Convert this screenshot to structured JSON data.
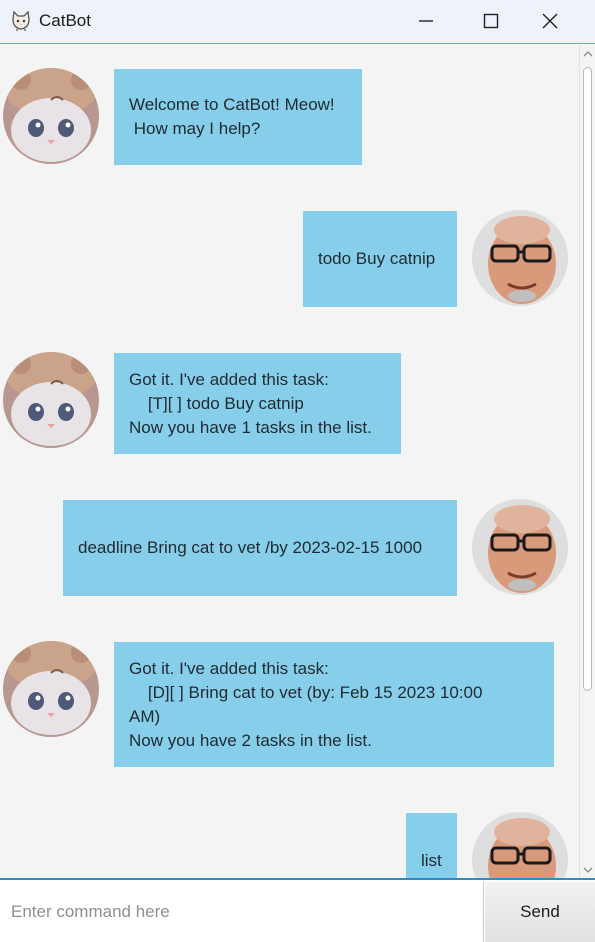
{
  "window": {
    "title": "CatBot"
  },
  "messages": [
    {
      "sender": "bot",
      "lines": [
        "Welcome to CatBot! Meow!",
        " How may I help?"
      ]
    },
    {
      "sender": "user",
      "lines": [
        "todo Buy catnip"
      ]
    },
    {
      "sender": "bot",
      "lines": [
        "Got it. I've added this task:",
        "    [T][ ] todo Buy catnip",
        "Now you have 1 tasks in the list."
      ]
    },
    {
      "sender": "user",
      "lines": [
        "deadline Bring cat to vet /by 2023-02-15 1000"
      ]
    },
    {
      "sender": "bot",
      "lines": [
        "Got it. I've added this task:",
        "    [D][ ] Bring cat to vet (by: Feb 15 2023 10:00",
        "AM)",
        "Now you have 2 tasks in the list."
      ]
    },
    {
      "sender": "user",
      "lines": [
        "list"
      ]
    }
  ],
  "input": {
    "placeholder": "Enter command here",
    "value": ""
  },
  "send_label": "Send",
  "colors": {
    "bubble": "#87ceeb",
    "accent": "#2b8dc9",
    "background": "#f4f4f4"
  },
  "icons": {
    "app": "cat-icon",
    "bot_avatar": "cat-avatar",
    "user_avatar": "user-avatar"
  }
}
